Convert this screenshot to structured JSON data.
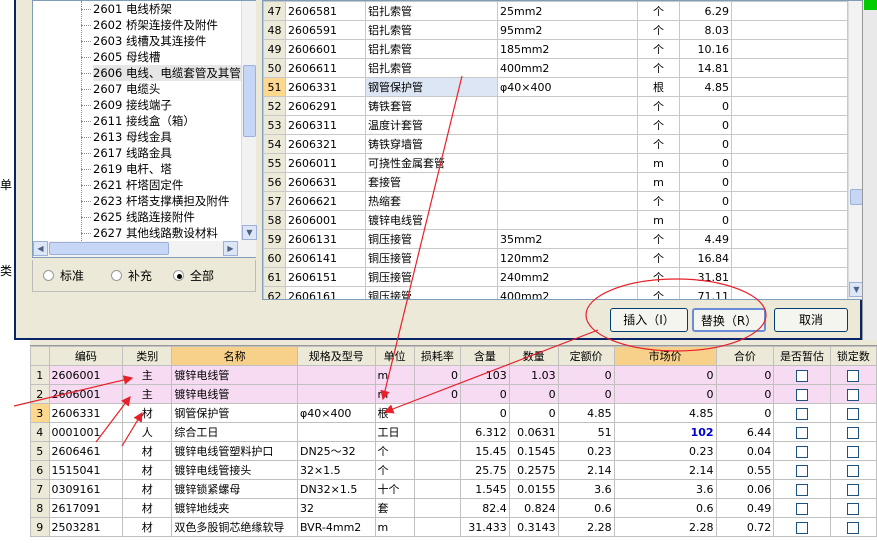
{
  "left_strip": {
    "label_1": "单",
    "label_2": "类"
  },
  "tree": {
    "items": [
      {
        "code": "2601",
        "label": "电线桥架"
      },
      {
        "code": "2602",
        "label": "桥架连接件及附件"
      },
      {
        "code": "2603",
        "label": "线槽及其连接件"
      },
      {
        "code": "2605",
        "label": "母线槽"
      },
      {
        "code": "2606",
        "label": "电线、电缆套管及其管"
      },
      {
        "code": "2607",
        "label": "电缆头"
      },
      {
        "code": "2609",
        "label": "接线端子"
      },
      {
        "code": "2611",
        "label": "接线盒（箱）"
      },
      {
        "code": "2613",
        "label": "母线金具"
      },
      {
        "code": "2617",
        "label": "线路金具"
      },
      {
        "code": "2619",
        "label": "电杆、塔"
      },
      {
        "code": "2621",
        "label": "杆塔固定件"
      },
      {
        "code": "2623",
        "label": "杆塔支撑横担及附件"
      },
      {
        "code": "2625",
        "label": "线路连接附件"
      },
      {
        "code": "2627",
        "label": "其他线路敷设材料"
      }
    ],
    "selected_index": 4
  },
  "radio": {
    "opt1": "标准",
    "opt2": "补充",
    "opt3": "全部",
    "checked": "opt3"
  },
  "material_rows": [
    {
      "no": "47",
      "code": "2606581",
      "name": "铝扎索管",
      "spec": "25mm2",
      "unit": "个",
      "price": "6.29"
    },
    {
      "no": "48",
      "code": "2606591",
      "name": "铝扎索管",
      "spec": "95mm2",
      "unit": "个",
      "price": "8.03"
    },
    {
      "no": "49",
      "code": "2606601",
      "name": "铝扎索管",
      "spec": "185mm2",
      "unit": "个",
      "price": "10.16"
    },
    {
      "no": "50",
      "code": "2606611",
      "name": "铝扎索管",
      "spec": "400mm2",
      "unit": "个",
      "price": "14.81"
    },
    {
      "no": "51",
      "code": "2606331",
      "name": "钢管保护管",
      "spec": "φ40×400",
      "unit": "根",
      "price": "4.85",
      "selected": true
    },
    {
      "no": "52",
      "code": "2606291",
      "name": "铸铁套管",
      "spec": "",
      "unit": "个",
      "price": "0"
    },
    {
      "no": "53",
      "code": "2606311",
      "name": "温度计套管",
      "spec": "",
      "unit": "个",
      "price": "0"
    },
    {
      "no": "54",
      "code": "2606321",
      "name": "铸铁穿墙管",
      "spec": "",
      "unit": "个",
      "price": "0"
    },
    {
      "no": "55",
      "code": "2606011",
      "name": "可挠性金属套管",
      "spec": "",
      "unit": "m",
      "price": "0"
    },
    {
      "no": "56",
      "code": "2606631",
      "name": "套接管",
      "spec": "",
      "unit": "m",
      "price": "0"
    },
    {
      "no": "57",
      "code": "2606621",
      "name": "热缩套",
      "spec": "",
      "unit": "个",
      "price": "0"
    },
    {
      "no": "58",
      "code": "2606001",
      "name": "镀锌电线管",
      "spec": "",
      "unit": "m",
      "price": "0"
    },
    {
      "no": "59",
      "code": "2606131",
      "name": "铜压接管",
      "spec": "35mm2",
      "unit": "个",
      "price": "4.49"
    },
    {
      "no": "60",
      "code": "2606141",
      "name": "铜压接管",
      "spec": "120mm2",
      "unit": "个",
      "price": "16.84"
    },
    {
      "no": "61",
      "code": "2606151",
      "name": "铜压接管",
      "spec": "240mm2",
      "unit": "个",
      "price": "31.81"
    },
    {
      "no": "62",
      "code": "2606161",
      "name": "铜压接管",
      "spec": "400mm2",
      "unit": "个",
      "price": "71.11"
    }
  ],
  "buttons": {
    "insert": "插入（I）",
    "replace": "替换（R）",
    "cancel": "取消"
  },
  "grid": {
    "headers": [
      "编码",
      "类别",
      "名称",
      "规格及型号",
      "单位",
      "损耗率",
      "含量",
      "数量",
      "定额价",
      "市场价",
      "合价",
      "是否暂估",
      "锁定数"
    ],
    "rows": [
      {
        "rn": "1",
        "code": "2606001",
        "cat": "主",
        "name": "镀锌电线管",
        "spec": "",
        "unit": "m",
        "loss": "0",
        "content": "103",
        "qty": "1.03",
        "quota": "0",
        "market": "0",
        "total": "0",
        "pink": true
      },
      {
        "rn": "2",
        "code": "2606001",
        "cat": "主",
        "name": "镀锌电线管",
        "spec": "",
        "unit": "m",
        "loss": "0",
        "content": "0",
        "qty": "0",
        "quota": "0",
        "market": "0",
        "total": "0",
        "pink": true
      },
      {
        "rn": "3",
        "code": "2606331",
        "cat": "材",
        "name": "钢管保护管",
        "spec": "φ40×400",
        "unit": "根",
        "loss": "",
        "content": "0",
        "qty": "0",
        "quota": "4.85",
        "market": "4.85",
        "total": "0",
        "sel": true
      },
      {
        "rn": "4",
        "code": "0001001",
        "cat": "人",
        "name": "综合工日",
        "spec": "",
        "unit": "工日",
        "loss": "",
        "content": "6.312",
        "qty": "0.0631",
        "quota": "51",
        "market": "102",
        "total": "6.44",
        "blue": true
      },
      {
        "rn": "5",
        "code": "2606461",
        "cat": "材",
        "name": "镀锌电线管塑料护口",
        "spec": "DN25～32",
        "unit": "个",
        "loss": "",
        "content": "15.45",
        "qty": "0.1545",
        "quota": "0.23",
        "market": "0.23",
        "total": "0.04"
      },
      {
        "rn": "6",
        "code": "1515041",
        "cat": "材",
        "name": "镀锌电线管接头",
        "spec": "32×1.5",
        "unit": "个",
        "loss": "",
        "content": "25.75",
        "qty": "0.2575",
        "quota": "2.14",
        "market": "2.14",
        "total": "0.55"
      },
      {
        "rn": "7",
        "code": "0309161",
        "cat": "材",
        "name": "镀锌锁紧螺母",
        "spec": "DN32×1.5",
        "unit": "十个",
        "loss": "",
        "content": "1.545",
        "qty": "0.0155",
        "quota": "3.6",
        "market": "3.6",
        "total": "0.06"
      },
      {
        "rn": "8",
        "code": "2617091",
        "cat": "材",
        "name": "镀锌地线夹",
        "spec": "32",
        "unit": "套",
        "loss": "",
        "content": "82.4",
        "qty": "0.824",
        "quota": "0.6",
        "market": "0.6",
        "total": "0.49"
      },
      {
        "rn": "9",
        "code": "2503281",
        "cat": "材",
        "name": "双色多股铜芯绝缘软导",
        "spec": "BVR-4mm2",
        "unit": "m",
        "loss": "",
        "content": "31.433",
        "qty": "0.3143",
        "quota": "2.28",
        "market": "2.28",
        "total": "0.72"
      }
    ]
  },
  "colors": {
    "annotation": "#e8202a",
    "pink_row": "#f7dbf3",
    "selected_header": "#f7d08a",
    "blue_value": "#0000cc"
  }
}
